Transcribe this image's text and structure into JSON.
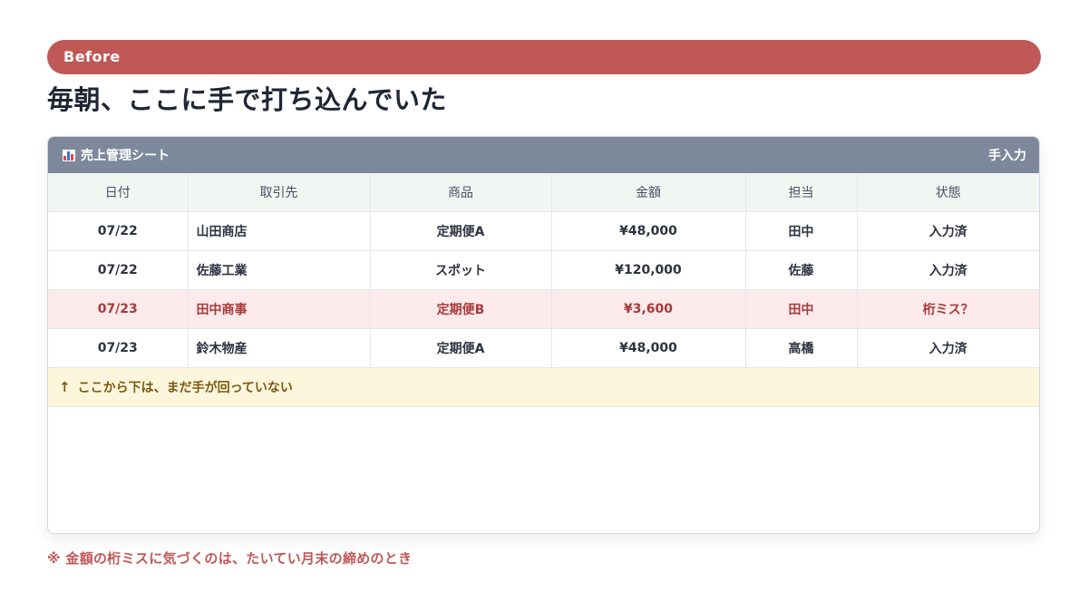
{
  "badge": {
    "label": "Before"
  },
  "heading": "毎朝、ここに手で打ち込んでいた",
  "sheet": {
    "title": "売上管理シート",
    "title_icon": "bar-chart-icon",
    "mode_label": "手入力",
    "columns": [
      "日付",
      "取引先",
      "商品",
      "金額",
      "担当",
      "状態"
    ],
    "rows": [
      {
        "date": "07/22",
        "client": "山田商店",
        "product": "定期便A",
        "amount": "¥48,000",
        "owner": "田中",
        "status": "入力済",
        "highlight": false
      },
      {
        "date": "07/22",
        "client": "佐藤工業",
        "product": "スポット",
        "amount": "¥120,000",
        "owner": "佐藤",
        "status": "入力済",
        "highlight": false
      },
      {
        "date": "07/23",
        "client": "田中商事",
        "product": "定期便B",
        "amount": "¥3,600",
        "owner": "田中",
        "status": "桁ミス？",
        "highlight": true
      },
      {
        "date": "07/23",
        "client": "鈴木物産",
        "product": "定期便A",
        "amount": "¥48,000",
        "owner": "高橋",
        "status": "入力済",
        "highlight": false
      }
    ],
    "note": {
      "arrow": "↑",
      "text": "ここから下は、まだ手が回っていない"
    }
  },
  "footnote": "※ 金額の桁ミスに気づくのは、たいてい月末の締めのとき",
  "colors": {
    "accent": "#c05858",
    "sheet_header": "#7d889b",
    "error_row_bg": "#fdeaea",
    "error_text": "#a63b3b",
    "note_bg": "#fef6dc"
  }
}
